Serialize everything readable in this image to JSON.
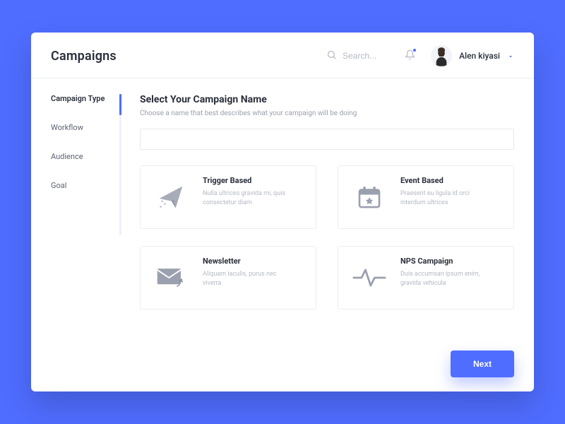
{
  "header": {
    "title": "Campaigns",
    "search_placeholder": "Search...",
    "user_name": "Alen kiyasi"
  },
  "sidebar": {
    "items": [
      {
        "label": "Campaign Type",
        "active": true
      },
      {
        "label": "Workflow",
        "active": false
      },
      {
        "label": "Audience",
        "active": false
      },
      {
        "label": "Goal",
        "active": false
      }
    ]
  },
  "main": {
    "heading": "Select Your Campaign Name",
    "subheading": "Choose a name that best describes what your campaign will be doing",
    "campaign_name_value": "",
    "next_label": "Next"
  },
  "cards": [
    {
      "title": "Trigger Based",
      "desc": "Nulla ultrices gravida mi, quis consectetur diam"
    },
    {
      "title": "Event Based",
      "desc": "Praesent eu ligula id orci interdum ultrices"
    },
    {
      "title": "Newsletter",
      "desc": "Aliquam iaculis, purus nec viverra"
    },
    {
      "title": "NPS Campaign",
      "desc": "Duis accumsan ipsum enim, gravida vehicula"
    }
  ]
}
